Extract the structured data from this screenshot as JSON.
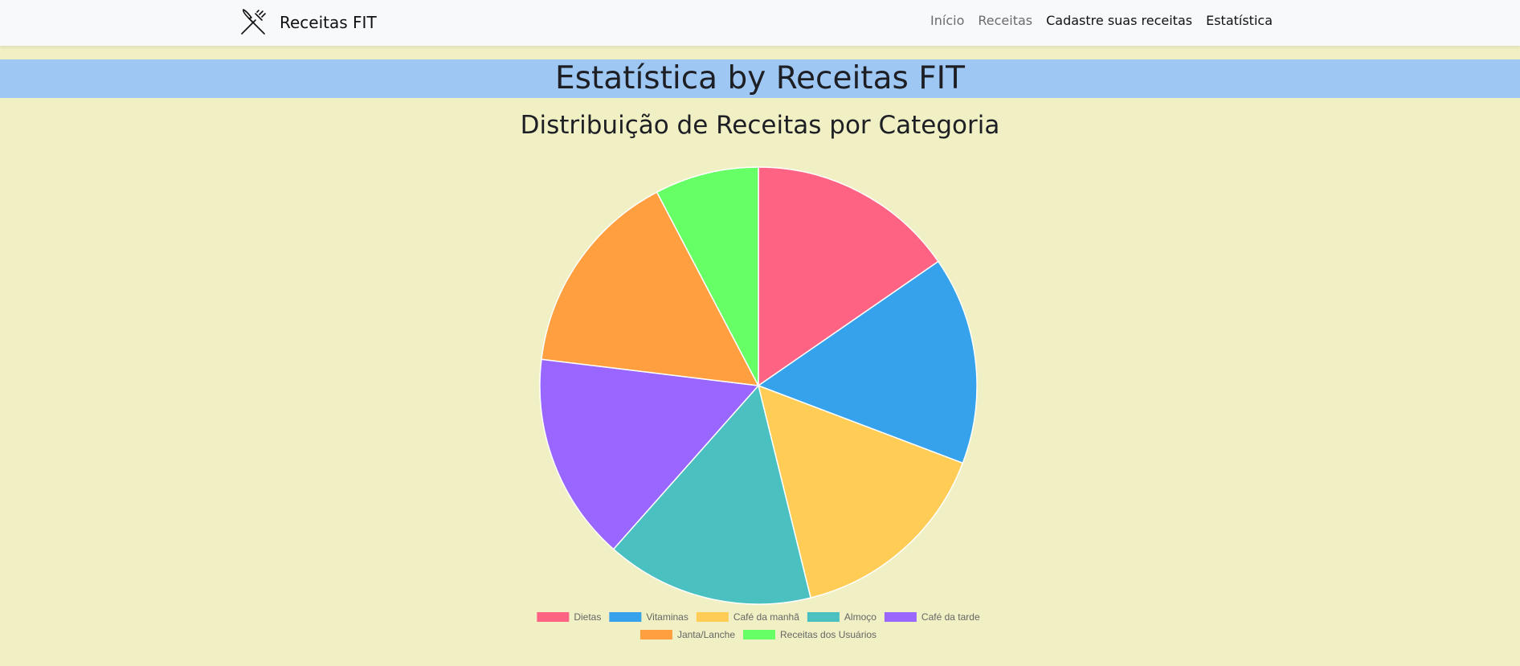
{
  "navbar": {
    "brand_name": "Receitas FIT",
    "brand_icon": "fork-knife-icon",
    "links": [
      {
        "label": "Início",
        "active": false
      },
      {
        "label": "Receitas",
        "active": false
      },
      {
        "label": "Cadastre suas receitas",
        "active": true
      },
      {
        "label": "Estatística",
        "active": true
      }
    ]
  },
  "page": {
    "title": "Estatística by Receitas FIT"
  },
  "colors": {
    "background": "#f0f0c4",
    "title_band": "#9fc7f3",
    "navbar": "#f8f9fb"
  },
  "chart_data": {
    "type": "pie",
    "title": "Distribuição de Receitas por Categoria",
    "labels": [
      "Dietas",
      "Vitaminas",
      "Café da manhã",
      "Almoço",
      "Café da tarde",
      "Janta/Lanche",
      "Receitas dos Usuários"
    ],
    "values": [
      6,
      6,
      6,
      6,
      6,
      6,
      3
    ],
    "colors": [
      "#ff6384",
      "#36a2eb",
      "#ffcd56",
      "#4bc0c0",
      "#9966ff",
      "#ff9f40",
      "#66ff66"
    ],
    "legend": "bottom"
  }
}
